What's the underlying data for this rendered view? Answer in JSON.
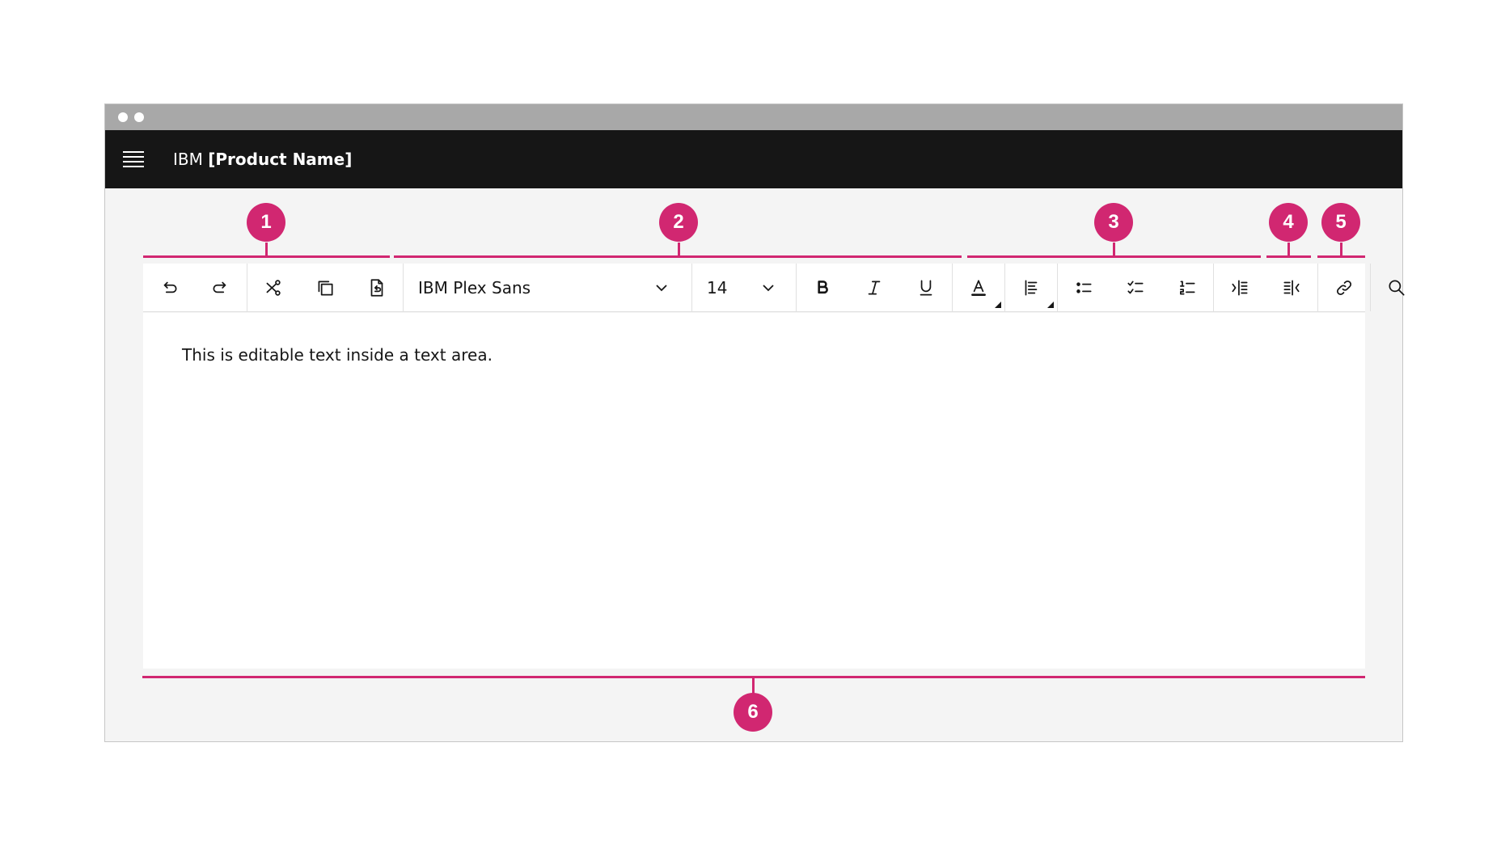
{
  "header": {
    "brand_prefix": "IBM",
    "product_name": "[Product Name]"
  },
  "toolbar": {
    "font_family": "IBM Plex Sans",
    "font_size": "14",
    "buttons": [
      "undo",
      "redo",
      "cut",
      "copy",
      "paste",
      "bold",
      "italic",
      "underline",
      "text-color",
      "align",
      "bulleted-list",
      "checklist",
      "numbered-list",
      "indent",
      "outdent",
      "link",
      "search"
    ]
  },
  "editor": {
    "text": "This is editable text inside a text area."
  },
  "annotations": [
    "1",
    "2",
    "3",
    "4",
    "5",
    "6"
  ],
  "colors": {
    "accent": "#d12771",
    "header": "#161616",
    "canvas": "#f4f4f4"
  }
}
